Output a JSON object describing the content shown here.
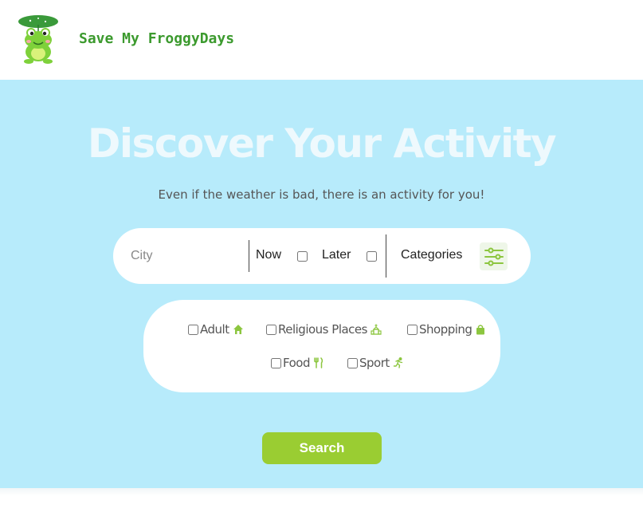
{
  "header": {
    "brand_name": "Save My FroggyDays",
    "logo_icon": "frog-logo-icon"
  },
  "hero": {
    "title": "Discover Your Activity",
    "subtitle": "Even if the weather is bad, there is an activity for you!"
  },
  "search_bar": {
    "city_placeholder": "City",
    "city_value": "",
    "now_label": "Now",
    "now_checked": false,
    "later_label": "Later",
    "later_checked": false,
    "categories_label": "Categories",
    "filter_icon": "sliders-icon"
  },
  "categories": [
    {
      "label": "Adult",
      "icon": "home-icon",
      "checked": false
    },
    {
      "label": "Religious Places",
      "icon": "church-icon",
      "checked": false
    },
    {
      "label": "Shopping",
      "icon": "shopping-bag-icon",
      "checked": false
    },
    {
      "label": "Food",
      "icon": "utensils-icon",
      "checked": false
    },
    {
      "label": "Sport",
      "icon": "running-icon",
      "checked": false
    }
  ],
  "search_button": {
    "label": "Search"
  },
  "colors": {
    "brand_green": "#3c9a2e",
    "accent_green": "#9acd32",
    "hero_bg": "#b7ebfb",
    "icon_green": "#8cc63f"
  }
}
